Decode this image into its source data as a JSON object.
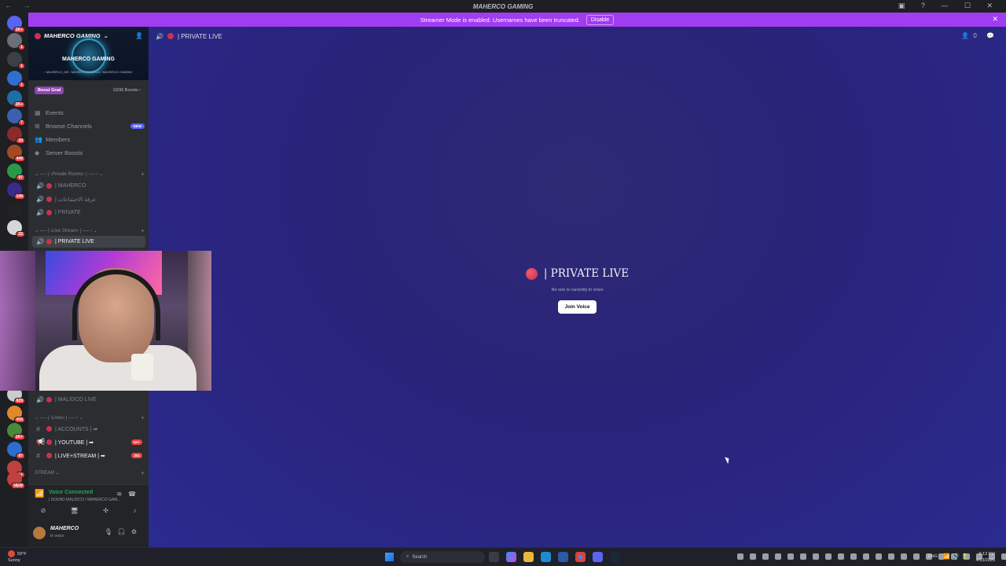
{
  "window": {
    "title": "MAHERCO GAMING",
    "nav": "← →",
    "controls": "▣ ? — ☐ ✕"
  },
  "banner": {
    "message": "Streamer Mode is enabled. Usernames have been truncated.",
    "disable_label": "Disable",
    "close": "✕"
  },
  "guilds": [
    {
      "badge": "1K+",
      "color": "#5865f2"
    },
    {
      "badge": "1",
      "color": "#6b6f77"
    },
    {
      "badge": "1",
      "color": "#3b3f46"
    },
    {
      "badge": "1",
      "color": "#2f6fd0"
    },
    {
      "badge": "2K+",
      "color": "#1d6fa8"
    },
    {
      "badge": "7",
      "color": "#3c5fb0"
    },
    {
      "badge": "20",
      "color": "#8a2a2a"
    },
    {
      "badge": "449",
      "color": "#a44a22"
    },
    {
      "badge": "97",
      "color": "#2a9a4a"
    },
    {
      "badge": "149",
      "color": "#3a2a8a"
    },
    {
      "badge": "",
      "color": "#222"
    },
    {
      "badge": "22",
      "color": "#d6d6d6"
    }
  ],
  "guilds_lower": [
    {
      "badge": "829",
      "color": "#ccc"
    },
    {
      "badge": "406",
      "color": "#e0882a"
    },
    {
      "badge": "1K+",
      "color": "#4a8a3a"
    },
    {
      "badge": "67",
      "color": "#2a6fd0"
    },
    {
      "badge": "9K+",
      "color": "#c04040"
    },
    {
      "badge": "NEW",
      "color": "#c04040"
    }
  ],
  "sidebar": {
    "server_name": "MAHERCO GAMING",
    "banner_text": "MAHERCO GAMING",
    "banner_sub": "/ MAHERCO_ME  /  MAHERCOGAMING  /  MAHERCO GAMING",
    "boost_goal": "Boost Goal",
    "boost_count": "10/36 Boosts",
    "menu": [
      {
        "icon": "calendar-icon",
        "glyph": "▦",
        "label": "Events"
      },
      {
        "icon": "browse-icon",
        "glyph": "⊞",
        "label": "Browse Channels",
        "badge": "NEW"
      },
      {
        "icon": "members-icon",
        "glyph": "👥",
        "label": "Members"
      },
      {
        "icon": "boost-icon",
        "glyph": "◆",
        "label": "Server Boosts"
      }
    ],
    "cat_private": "⌄ ── | ‹Private Rooms› | ── ‹ ⌄",
    "private_channels": [
      "| MAHERCO",
      "| غرفة الاجتماعات",
      "| PRIVATE"
    ],
    "cat_live": "⌄ ── | ‹Live Stream› | ── ‹ ⌄",
    "live_active": "| PRIVATE LIVE",
    "hidden_channel": "| MALIDCO LIVE",
    "cat_lives": "⌄ ── | ‹Lives› | ── ‹ ⌄",
    "text_channels": [
      {
        "label": "| ACCOUNTS | ➡",
        "badge": ""
      },
      {
        "label": "| YOUTUBE | ➡",
        "badge": "1K+"
      },
      {
        "label": "| LIVE+STREAM | ➡",
        "badge": "301"
      }
    ],
    "cat_stream": "STREAM ⌄",
    "voice": {
      "title": "Voice Connected",
      "subtitle": "| SOUND MALIDCO / MAHERCO GAM...",
      "signal": "📶"
    },
    "user": {
      "name": "MAHERCO",
      "status": "In voice"
    }
  },
  "main": {
    "channel_name": "| PRIVATE LIVE",
    "member_count": "0",
    "center_title": "| PRIVATE LIVE",
    "center_sub": "No one is currently in voice",
    "join_label": "Join Voice"
  },
  "taskbar": {
    "weather_temp": "59°F",
    "weather_desc": "Sunny",
    "search_placeholder": "Search",
    "lang": "ENG",
    "time": "6:13 PM",
    "date": "4/13/2026"
  }
}
